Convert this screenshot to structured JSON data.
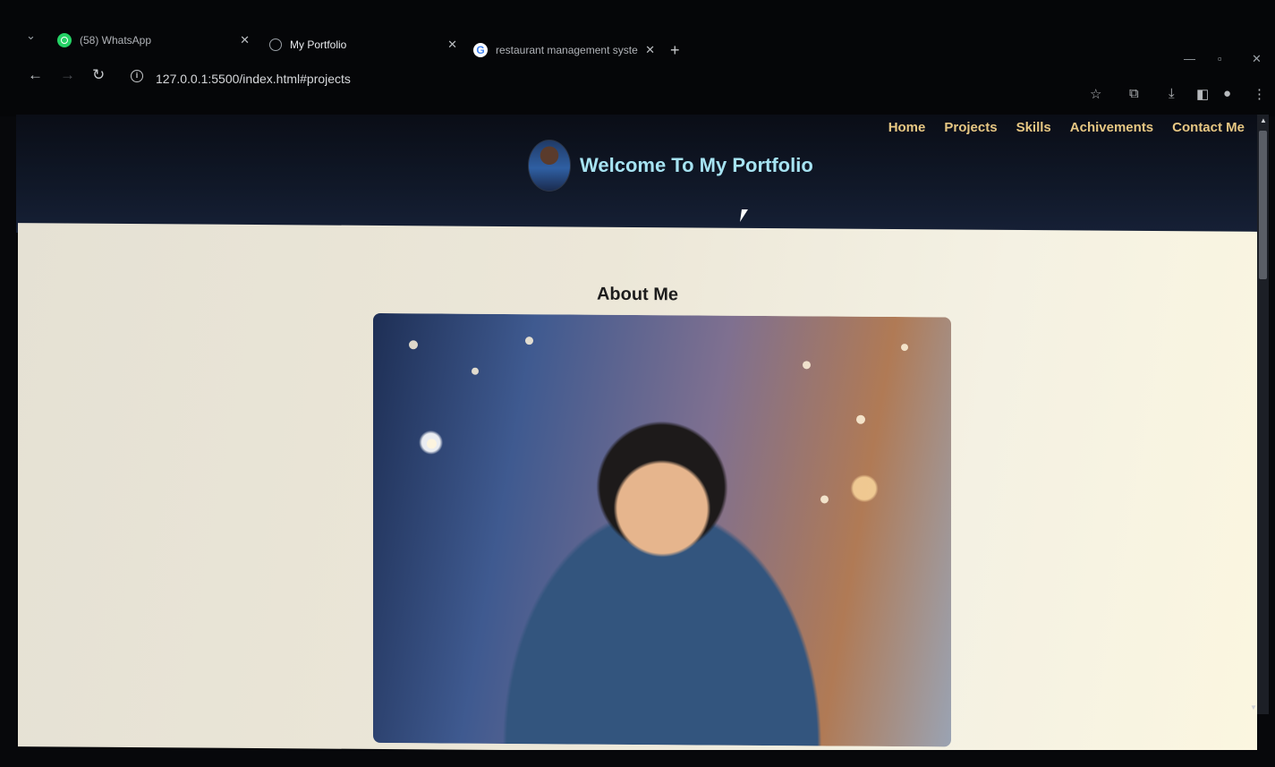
{
  "browser": {
    "tabs": [
      {
        "label": "(58) WhatsApp",
        "favicon": "whatsapp-icon"
      },
      {
        "label": "My Portfolio",
        "favicon": "globe-icon",
        "active": true
      },
      {
        "label": "restaurant management syste",
        "favicon": "google-icon"
      }
    ],
    "url": "127.0.0.1:5500/index.html#projects"
  },
  "site": {
    "nav": [
      "Home",
      "Projects",
      "Skills",
      "Achivements",
      "Contact Me"
    ],
    "title": "Welcome To My Portfolio"
  },
  "about": {
    "heading": "About Me"
  },
  "colors": {
    "nav_text": "#e7c783",
    "title_text": "#a6e3f2",
    "header_bg": "#101828"
  }
}
